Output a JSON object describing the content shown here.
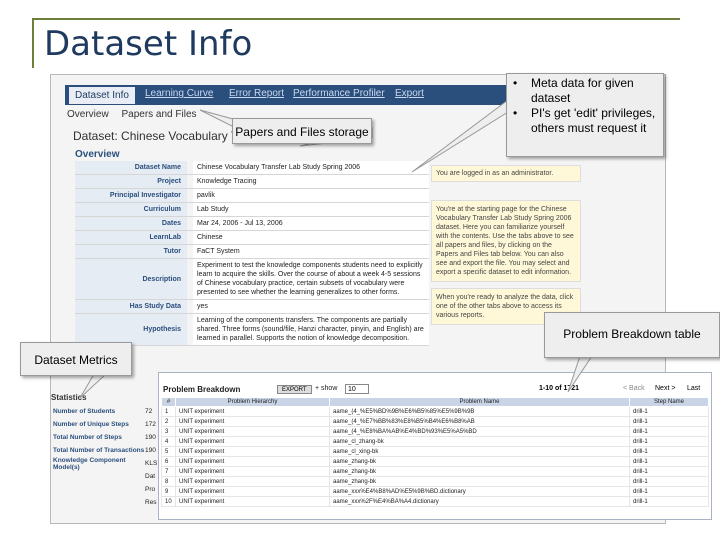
{
  "slide": {
    "title": "Dataset Info"
  },
  "tabs": [
    {
      "label": "Dataset Info"
    },
    {
      "label": "Learning Curve"
    },
    {
      "label": "Error Report"
    },
    {
      "label": "Performance Profiler"
    },
    {
      "label": "Export"
    }
  ],
  "subnav": {
    "overview": "Overview",
    "papers_files": "Papers and Files"
  },
  "dataset_title": "Dataset: Chinese Vocabulary Transfer",
  "overview_heading": "Overview",
  "overview": [
    {
      "key": "Dataset Name",
      "value": "Chinese Vocabulary Transfer Lab Study Spring 2006"
    },
    {
      "key": "Project",
      "value": "Knowledge Tracing"
    },
    {
      "key": "Principal Investigator",
      "value": "pavlik"
    },
    {
      "key": "Curriculum",
      "value": "Lab Study"
    },
    {
      "key": "Dates",
      "value": "Mar 24, 2006 - Jul 13, 2006"
    },
    {
      "key": "LearnLab",
      "value": "Chinese"
    },
    {
      "key": "Tutor",
      "value": "FaCT System"
    },
    {
      "key": "Description",
      "value": "Experiment to test the knowledge components students need to explicitly learn to acquire the skills. Over the course of about a week 4-5 sessions of Chinese vocabulary practice, certain subsets of vocabulary were presented to see whether the learning generalizes to other forms."
    },
    {
      "key": "Has Study Data",
      "value": "yes"
    },
    {
      "key": "Hypothesis",
      "value": "Learning of the components transfers. The components are partially shared. Three forms (sound/file, Hanzi character, pinyin, and English) are learned in parallel. Supports the notion of knowledge decomposition."
    }
  ],
  "logged_in": "You are logged in as an administrator.",
  "about_text": "You're at the starting page for the Chinese Vocabulary Transfer Lab Study Spring 2006 dataset. Here you can familiarize yourself with the contents. Use the tabs above to see all papers and files, by clicking on the Papers and Files tab below. You can also see and export the file. You may select and export a specific dataset to edit information.",
  "analyze_text": "When you're ready to analyze the data, click one of the other tabs above to access its various reports.",
  "statistics": {
    "heading": "Statistics",
    "rows": [
      {
        "label": "Number of Students",
        "value": "72"
      },
      {
        "label": "Number of Unique Steps",
        "value": "172"
      },
      {
        "label": "Total Number of Steps",
        "value": "190"
      },
      {
        "label": "Total Number of Transactions",
        "value": "190"
      },
      {
        "label": "Knowledge Component Model(s)",
        "value": "KLS"
      }
    ],
    "more": [
      "Dat",
      "Pro",
      "Res"
    ]
  },
  "problem_breakdown": {
    "title": "Problem Breakdown",
    "export_label": "EXPORT",
    "more_label": "+ show",
    "rows_per_page": "10",
    "count": "1-10 of 1721",
    "prev": "< Back",
    "next": "Next >",
    "last": "Last",
    "columns": [
      "#",
      "Problem Hierarchy",
      "Problem Name",
      "Step Name"
    ],
    "rows": [
      {
        "n": "1",
        "hier": "UNIT experiment",
        "name": "aame_(4_%E5%BD%9B%E6%B5%85%E5%9B%9B",
        "step": "drill-1"
      },
      {
        "n": "2",
        "hier": "UNIT experiment",
        "name": "aame_(4_%E7%BB%83%E8%B5%B4%E6%B8%AB",
        "step": "drill-1"
      },
      {
        "n": "3",
        "hier": "UNIT experiment",
        "name": "aame_(4_%E8%BA%AB%E4%BD%93%E5%A5%BD",
        "step": "drill-1"
      },
      {
        "n": "4",
        "hier": "UNIT experiment",
        "name": "aame_cl_zhang-bk",
        "step": "drill-1"
      },
      {
        "n": "5",
        "hier": "UNIT experiment",
        "name": "aame_cl_xing-bk",
        "step": "drill-1"
      },
      {
        "n": "6",
        "hier": "UNIT experiment",
        "name": "aame_zhang-bk",
        "step": "drill-1"
      },
      {
        "n": "7",
        "hier": "UNIT experiment",
        "name": "aame_zhang-bk",
        "step": "drill-1"
      },
      {
        "n": "8",
        "hier": "UNIT experiment",
        "name": "aame_zhang-bk",
        "step": "drill-1"
      },
      {
        "n": "9",
        "hier": "UNIT experiment",
        "name": "aame_xxx%E4%B8%AD%E5%9B%BD.dictionary",
        "step": "drill-1"
      },
      {
        "n": "10",
        "hier": "UNIT experiment",
        "name": "aame_xxx%2F%E4%BA%A4.dictionary",
        "step": "drill-1"
      }
    ]
  },
  "callouts": {
    "papers": "Papers and Files storage",
    "meta": [
      "Meta data for given dataset",
      "PI's get 'edit' privileges, others must request it"
    ],
    "problem": "Problem Breakdown table",
    "metrics": "Dataset Metrics"
  },
  "colors": {
    "title": "#1f3a5f",
    "frame": "#6b7f3a",
    "tabbar": "#2b4f7d",
    "callout_bg": "#eeeeee"
  }
}
